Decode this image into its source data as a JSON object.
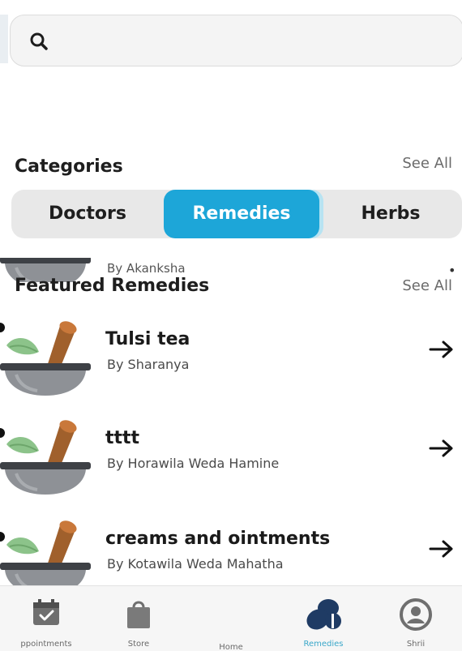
{
  "search": {
    "placeholder": "",
    "value": ""
  },
  "categories": {
    "title": "Categories",
    "see_all": "See All",
    "options": [
      "Doctors",
      "Remedies",
      "Herbs"
    ],
    "selected": "Remedies"
  },
  "peek_item": {
    "author": "By Akanksha"
  },
  "featured": {
    "title": "Featured Remedies",
    "see_all": "See All",
    "items": [
      {
        "name": "Tulsi tea",
        "author": "By Sharanya"
      },
      {
        "name": "tttt",
        "author": "By Horawila Weda Hamine"
      },
      {
        "name": "creams and ointments",
        "author": "By Kotawila Weda Mahatha"
      }
    ]
  },
  "tabbar": {
    "tabs": [
      {
        "label": "ppointments",
        "icon": "calendar-icon"
      },
      {
        "label": "Store",
        "icon": "shopping-bag-icon"
      },
      {
        "label": "Home",
        "icon": "home-icon"
      },
      {
        "label": "Remedies",
        "icon": "pills-icon"
      },
      {
        "label": "Shrii",
        "icon": "profile-icon"
      }
    ],
    "active": "Remedies"
  },
  "colors": {
    "accent": "#1da6d8",
    "text": "#1e1e1e",
    "muted": "#6a6a6a",
    "segment_bg": "#e8e8e8",
    "icon_navy": "#1f3b64"
  }
}
